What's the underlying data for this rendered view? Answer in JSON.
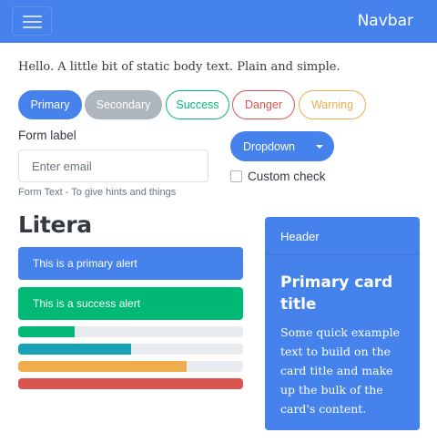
{
  "navbar": {
    "brand": "Navbar",
    "toggler_icon": "hamburger-icon"
  },
  "body_text": "Hello. A little bit of static body text. Plain and simple.",
  "buttons": {
    "primary": "Primary",
    "secondary": "Secondary",
    "success": "Success",
    "danger": "Danger",
    "warning": "Warning"
  },
  "form": {
    "label": "Form label",
    "email_placeholder": "Enter email",
    "help_text": "Form Text - To give hints and things"
  },
  "dropdown": {
    "label": "Dropdown",
    "icon": "caret-down-icon"
  },
  "checkbox": {
    "label": "Custom check",
    "checked": false
  },
  "heading": "Litera",
  "alerts": {
    "primary": "This is a primary alert",
    "success": "This is a success alert"
  },
  "progress_bars": [
    {
      "value": 25,
      "color": "#02b875"
    },
    {
      "value": 50,
      "color": "#17a2b8"
    },
    {
      "value": 75,
      "color": "#f0ad4e"
    },
    {
      "value": 100,
      "color": "#d9534f"
    }
  ],
  "card": {
    "header": "Header",
    "title": "Primary card title",
    "text": "Some quick example text to build on the card title and make up the bulk of the card's content."
  },
  "colors": {
    "primary": "#4582ec",
    "secondary": "#adb5bd",
    "success": "#02b875",
    "danger": "#d9534f",
    "warning": "#f0ad4e",
    "info": "#17a2b8"
  }
}
